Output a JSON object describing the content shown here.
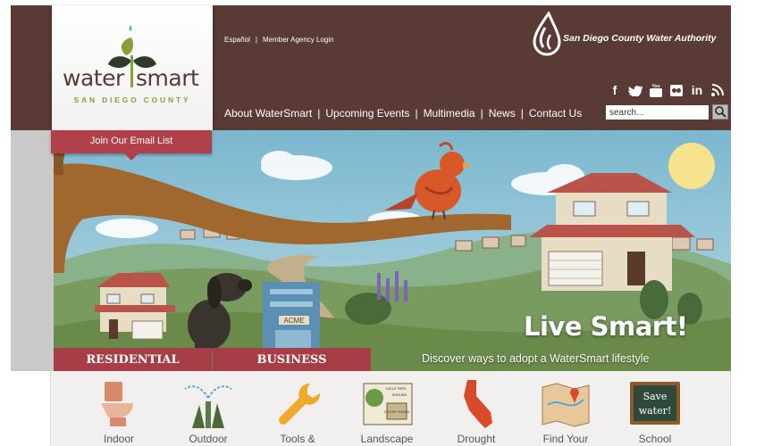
{
  "header": {
    "logo": {
      "word_left": "water",
      "word_right": "smart",
      "subtitle": "SAN DIEGO COUNTY"
    },
    "top_links": [
      {
        "label": "Español"
      },
      {
        "label": "Member Agency Login"
      }
    ],
    "authority_name": "San Diego County Water Authority",
    "social_icons": [
      {
        "name": "facebook-icon",
        "glyph": "f"
      },
      {
        "name": "twitter-icon",
        "glyph": "🐦"
      },
      {
        "name": "youtube-icon",
        "glyph": "▶"
      },
      {
        "name": "flickr-icon",
        "glyph": "●●"
      },
      {
        "name": "linkedin-icon",
        "glyph": "in"
      },
      {
        "name": "rss-icon",
        "glyph": "◔"
      }
    ],
    "nav": [
      {
        "label": "About WaterSmart"
      },
      {
        "label": "Upcoming Events"
      },
      {
        "label": "Multimedia"
      },
      {
        "label": "News"
      },
      {
        "label": "Contact Us"
      }
    ],
    "search": {
      "value": "search..."
    }
  },
  "hero": {
    "email_tab": "Join Our Email List",
    "tabs": [
      {
        "label": "RESIDENTIAL"
      },
      {
        "label": "BUSINESS"
      }
    ],
    "headline": "Live Smart!",
    "tagline": "Discover ways to adopt a WaterSmart lifestyle",
    "building_sign": "ACME"
  },
  "categories": [
    {
      "label": "Indoor",
      "icon": "toilet-icon"
    },
    {
      "label": "Outdoor",
      "icon": "sprinkler-icon"
    },
    {
      "label": "Tools &",
      "icon": "wrench-icon"
    },
    {
      "label": "Landscape",
      "icon": "landscape-plan-icon"
    },
    {
      "label": "Drought",
      "icon": "california-map-icon"
    },
    {
      "label": "Find Your",
      "icon": "map-pin-icon"
    },
    {
      "label": "School",
      "icon": "chalkboard-icon"
    }
  ],
  "landscape_icon_text": {
    "tree": "10X10 TREE",
    "shrubs": "SHRUBS",
    "house": "2-STORY HOUSE"
  },
  "chalkboard_text": [
    "Save",
    "water!"
  ],
  "colors": {
    "brand_brown": "#5a3a34",
    "accent_red": "#a73d46",
    "brand_green": "#86a13a"
  }
}
